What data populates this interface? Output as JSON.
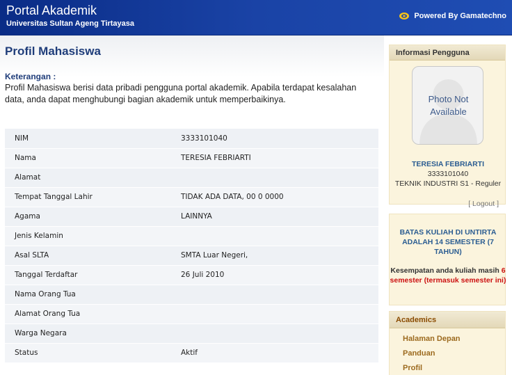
{
  "header": {
    "title": "Portal Akademik",
    "subtitle": "Universitas Sultan Ageng Tirtayasa",
    "powered_by": "Powered By Gamatechno"
  },
  "main": {
    "page_title": "Profil Mahasiswa",
    "description_label": "Keterangan :",
    "description_text": "Profil Mahasiswa berisi data pribadi pengguna portal akademik. Apabila terdapat kesalahan data, anda dapat menghubungi bagian akademik untuk memperbaikinya.",
    "profile": [
      {
        "label": "NIM",
        "value": "3333101040"
      },
      {
        "label": "Nama",
        "value": "TERESIA FEBRIARTI"
      },
      {
        "label": "Alamat",
        "value": ""
      },
      {
        "label": "Tempat Tanggal Lahir",
        "value": "TIDAK ADA DATA, 00 0 0000"
      },
      {
        "label": "Agama",
        "value": "LAINNYA"
      },
      {
        "label": "Jenis Kelamin",
        "value": ""
      },
      {
        "label": "Asal SLTA",
        "value": "SMTA Luar Negeri,"
      },
      {
        "label": "Tanggal Terdaftar",
        "value": "26 Juli 2010"
      },
      {
        "label": "Nama Orang Tua",
        "value": ""
      },
      {
        "label": "Alamat Orang Tua",
        "value": ""
      },
      {
        "label": "Warga Negara",
        "value": ""
      },
      {
        "label": "Status",
        "value": "Aktif"
      }
    ]
  },
  "sidebar": {
    "user_panel": {
      "heading": "Informasi Pengguna",
      "photo_text": "Photo Not Available",
      "name": "TERESIA FEBRIARTI",
      "nim": "3333101040",
      "program": "TEKNIK INDUSTRI S1 - Reguler",
      "logout_label": "[ Logout ]"
    },
    "notice": {
      "title": "BATAS KULIAH DI UNTIRTA ADALAH 14 SEMESTER (7 TAHUN)",
      "body_prefix": "Kesempatan anda kuliah masih",
      "body_highlight": "6 semester (termasuk semester ini)"
    },
    "academics": {
      "heading": "Academics",
      "items": [
        {
          "label": "Halaman Depan"
        },
        {
          "label": "Panduan"
        },
        {
          "label": "Profil"
        }
      ]
    }
  },
  "colors": {
    "header_blue": "#1a43a6",
    "title_blue": "#1f3d7a",
    "highlight_red": "#cc1111",
    "menu_brown": "#9c6a1e"
  },
  "icons": {
    "powered_logo": "gamatechno-logo-icon",
    "photo": "user-silhouette-icon"
  }
}
